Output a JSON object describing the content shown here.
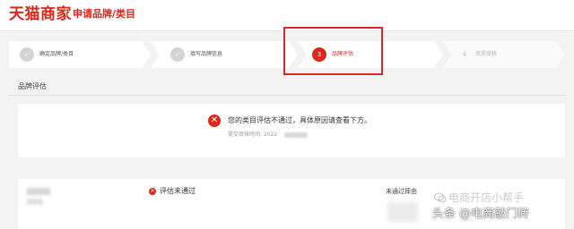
{
  "header": {
    "logo_text": "天猫商家",
    "page_title": "申请品牌/类目"
  },
  "steps": [
    {
      "badge": "✓",
      "label": "确定品牌/类目",
      "state": "done"
    },
    {
      "badge": "✓",
      "label": "填写品牌信息",
      "state": "done"
    },
    {
      "badge": "3",
      "label": "品牌评估",
      "state": "active"
    },
    {
      "badge": "4",
      "label": "资质审核",
      "state": "idle"
    }
  ],
  "section": {
    "title": "品牌评估"
  },
  "result": {
    "icon": "error-icon",
    "message": "您的类目评估不通过，具体原因请查看下方。",
    "submit_time_label": "提交审核时间: 2022"
  },
  "row": {
    "status_text": "评估未通过",
    "appeal_text": "未通过摔由"
  },
  "watermark": {
    "line1": "电商开店小帮手",
    "line2": "头条 @电商敲门砖"
  },
  "colors": {
    "brand_red": "#e1251b",
    "highlight_red": "#e0252b"
  }
}
